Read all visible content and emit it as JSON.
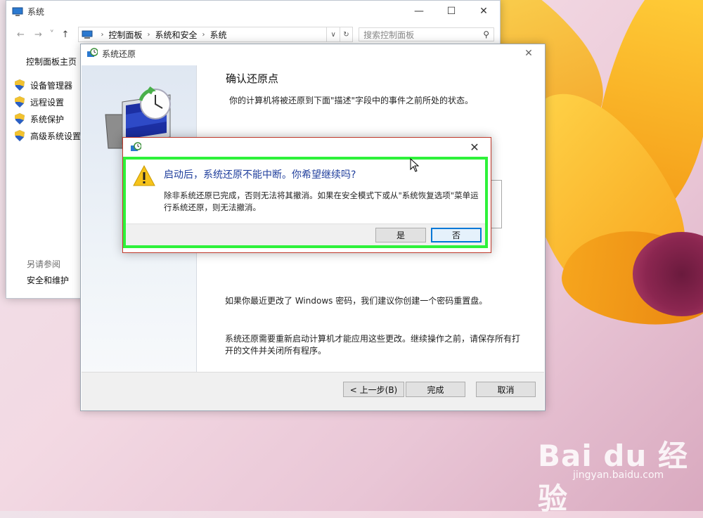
{
  "system_window": {
    "title": "系统",
    "caption": {
      "minimize": "—",
      "maximize": "☐",
      "close": "✕"
    },
    "nav": {
      "back": "←",
      "forward": "→",
      "recent": "˅",
      "up": "↑"
    },
    "breadcrumb": [
      "控制面板",
      "系统和安全",
      "系统"
    ],
    "search_placeholder": "搜索控制面板",
    "left_nav": {
      "home": "控制面板主页",
      "items": [
        "设备管理器",
        "远程设置",
        "系统保护",
        "高级系统设置"
      ],
      "see_also_label": "另请参阅",
      "see_also_link": "安全和维护"
    }
  },
  "restore_window": {
    "title": "系统还原",
    "heading": "确认还原点",
    "description": "你的计算机将被还原到下面\"描述\"字段中的事件之前所处的状态。",
    "password_note": "如果你最近更改了 Windows 密码，我们建议你创建一个密码重置盘。",
    "restart_note": "系统还原需要重新启动计算机才能应用这些更改。继续操作之前，请保存所有打开的文件并关闭所有程序。",
    "buttons": {
      "back": "< 上一步(B)",
      "finish": "完成",
      "cancel": "取消"
    },
    "close": "✕"
  },
  "confirm_dialog": {
    "heading": "启动后，系统还原不能中断。你希望继续吗?",
    "message": "除非系统还原已完成，否则无法将其撤消。如果在安全模式下或从\"系统恢复选项\"菜单运行系统还原，则无法撤消。",
    "yes": "是",
    "no": "否",
    "close": "✕",
    "highlight_color": "#2ef23a"
  },
  "watermark": {
    "logo": "Bai du 经验",
    "url": "jingyan.baidu.com"
  }
}
